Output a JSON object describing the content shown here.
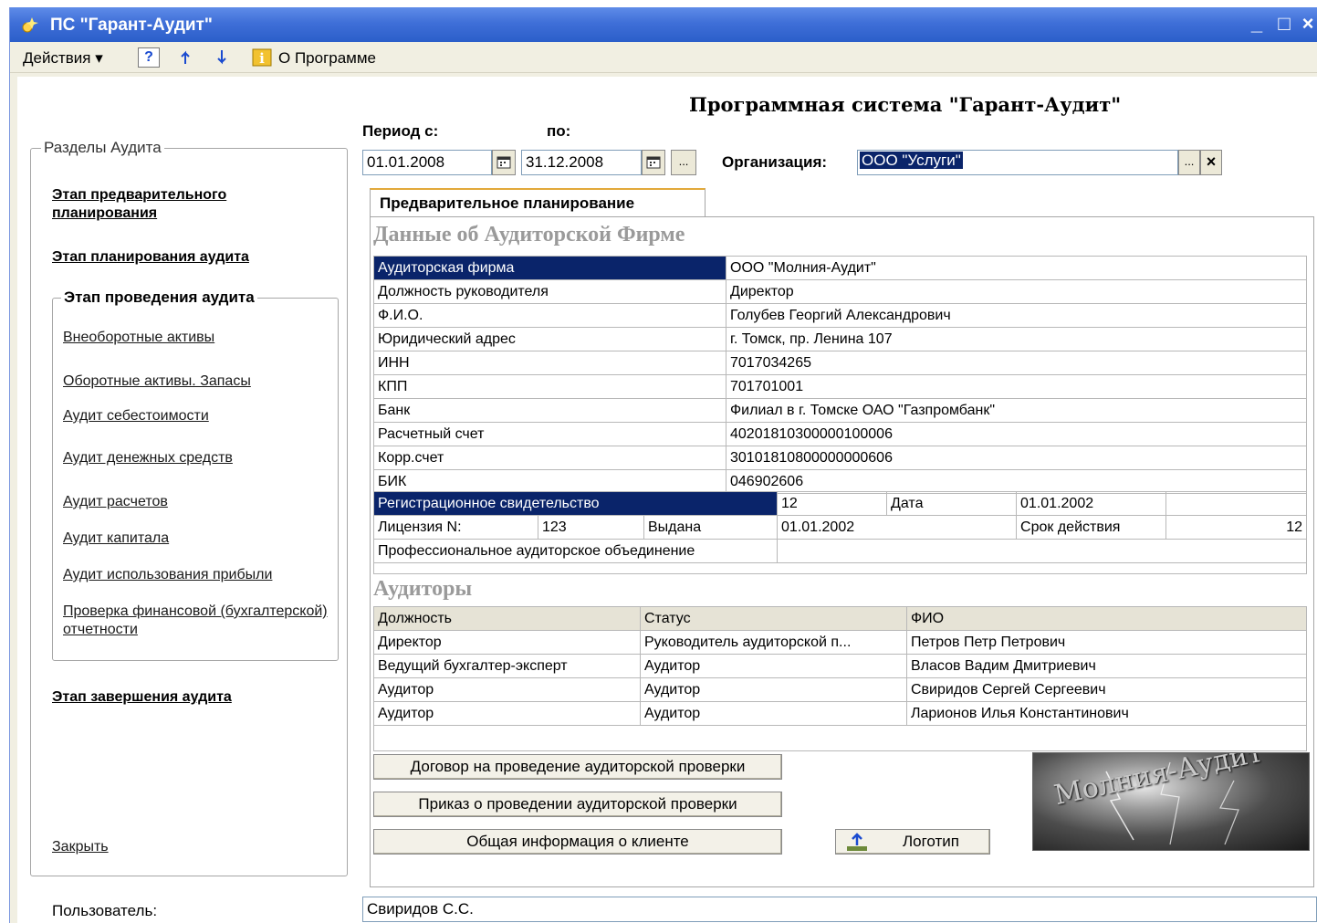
{
  "window": {
    "title": "ПС \"Гарант-Аудит\"",
    "minimize": "_",
    "maximize": "□",
    "close": "×"
  },
  "menubar": {
    "actions": "Действия ▾",
    "help_glyph": "?",
    "about": "О Программе"
  },
  "header": {
    "system_title": "Программная система \"Гарант-Аудит\""
  },
  "period": {
    "from_label": "Период с:",
    "to_label": "по:",
    "from_value": "01.01.2008",
    "to_value": "31.12.2008",
    "ellipsis": "..."
  },
  "organization": {
    "label": "Организация:",
    "value": "ООО \"Услуги\"",
    "ellipsis": "...",
    "clear": "×"
  },
  "sidebar": {
    "group_title": "Разделы Аудита",
    "stage1": "Этап предварительного планирования",
    "stage2": "Этап планирования аудита",
    "stage3_title": "Этап проведения аудита",
    "links": [
      "Внеоборотные активы",
      "Оборотные активы. Запасы",
      "Аудит себестоимости",
      "Аудит денежных средств",
      "Аудит расчетов",
      "Аудит капитала",
      "Аудит использования прибыли",
      "Проверка финансовой (бухгалтерской) отчетности"
    ],
    "stage4": "Этап завершения аудита",
    "close": "Закрыть"
  },
  "tab": {
    "label": "Предварительное планирование"
  },
  "firm": {
    "section_title": "Данные об Аудиторской Фирме",
    "rows": [
      {
        "label": "Аудиторская фирма",
        "value": "ООО \"Молния-Аудит\""
      },
      {
        "label": "Должность руководителя",
        "value": "Директор"
      },
      {
        "label": "Ф.И.О.",
        "value": "Голубев Георгий Александрович"
      },
      {
        "label": "Юридический адрес",
        "value": "г. Томск, пр. Ленина 107"
      },
      {
        "label": "ИНН",
        "value": "7017034265"
      },
      {
        "label": "КПП",
        "value": "701701001"
      },
      {
        "label": "Банк",
        "value": "Филиал в г. Томске ОАО \"Газпромбанк\""
      },
      {
        "label": "Расчетный счет",
        "value": "40201810300000100006"
      },
      {
        "label": "Корр.счет",
        "value": "30101810800000000606"
      },
      {
        "label": "БИК",
        "value": "046902606"
      }
    ],
    "reg_label": "Регистрационное свидетельство",
    "reg_number": "12",
    "reg_date_label": "Дата",
    "reg_date": "01.01.2002",
    "license_label": "Лицензия N:",
    "license_number": "123",
    "issued_label": "Выдана",
    "issued_date": "01.01.2002",
    "validity_label": "Срок действия",
    "validity_value": "12",
    "association_label": "Профессиональное аудиторское объединение",
    "association_value": ""
  },
  "auditors": {
    "section_title": "Аудиторы",
    "columns": [
      "Должность",
      "Статус",
      "ФИО"
    ],
    "rows": [
      [
        "Директор",
        "Руководитель аудиторской п...",
        "Петров Петр Петрович"
      ],
      [
        "Ведущий бухгалтер-эксперт",
        "Аудитор",
        "Власов Вадим Дмитриевич"
      ],
      [
        "Аудитор",
        "Аудитор",
        "Свиридов Сергей Сергеевич"
      ],
      [
        "Аудитор",
        "Аудитор",
        "Ларионов Илья Константинович"
      ]
    ]
  },
  "buttons": {
    "contract": "Договор на проведение аудиторской проверки",
    "order": "Приказ о проведении аудиторской проверки",
    "client_info": "Общая информация о клиенте",
    "logo": "Логотип"
  },
  "logo_image": {
    "text": "Молния-Аудит"
  },
  "footer": {
    "user_label": "Пользователь:",
    "user_value": "Свиридов С.С."
  }
}
